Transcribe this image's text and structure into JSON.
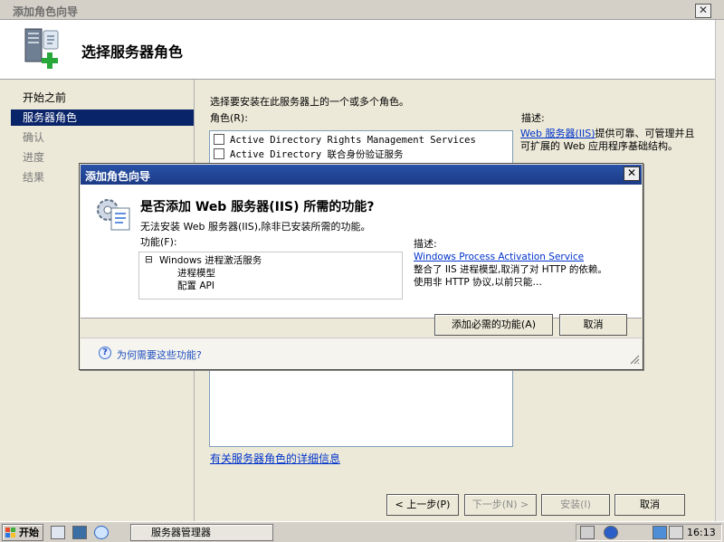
{
  "window": {
    "title": "添加角色向导",
    "close": "✕"
  },
  "header": {
    "title": "选择服务器角色"
  },
  "nav": {
    "items": [
      {
        "label": "开始之前",
        "state": "normal"
      },
      {
        "label": "服务器角色",
        "state": "selected"
      },
      {
        "label": "确认",
        "state": "dim"
      },
      {
        "label": "进度",
        "state": "dim"
      },
      {
        "label": "结果",
        "state": "dim"
      }
    ]
  },
  "content": {
    "intro": "选择要安装在此服务器上的一个或多个角色。",
    "roles_label": "角色(R):",
    "roles": [
      {
        "name": "Active Directory Rights Management Services",
        "checked": false
      },
      {
        "name": "Active Directory 联合身份验证服务",
        "checked": false
      }
    ],
    "desc_label": "描述:",
    "desc_link": "Web 服务器(IIS)",
    "desc_text": "提供可靠、可管理并且可扩展的 Web 应用程序基础结构。",
    "more_info_link": "有关服务器角色的详细信息"
  },
  "buttons": {
    "prev": "< 上一步(P)",
    "next": "下一步(N) >",
    "install": "安装(I)",
    "cancel": "取消"
  },
  "dialog": {
    "title": "添加角色向导",
    "heading": "是否添加 Web 服务器(IIS) 所需的功能?",
    "cannot_install": "无法安装 Web 服务器(IIS),除非已安装所需的功能。",
    "features_label": "功能(F):",
    "features": [
      {
        "label": "Windows 进程激活服务",
        "level": 0,
        "expander": "⊟"
      },
      {
        "label": "进程模型",
        "level": 1
      },
      {
        "label": "配置 API",
        "level": 1
      }
    ],
    "desc_label": "描述:",
    "desc_link": "Windows Process Activation Service",
    "desc_text": "整合了 IIS 进程模型,取消了对 HTTP 的依赖。使用非 HTTP 协议,以前只能…",
    "add_button": "添加必需的功能(A)",
    "cancel_button": "取消",
    "help_link": "为何需要这些功能?",
    "help_icon": "?"
  },
  "taskbar": {
    "start": "开始",
    "task": "服务器管理器",
    "clock": "16:13"
  },
  "colors": {
    "selection": "#0a246a",
    "dialog_title": "#2852a8",
    "link": "#0033cc"
  }
}
